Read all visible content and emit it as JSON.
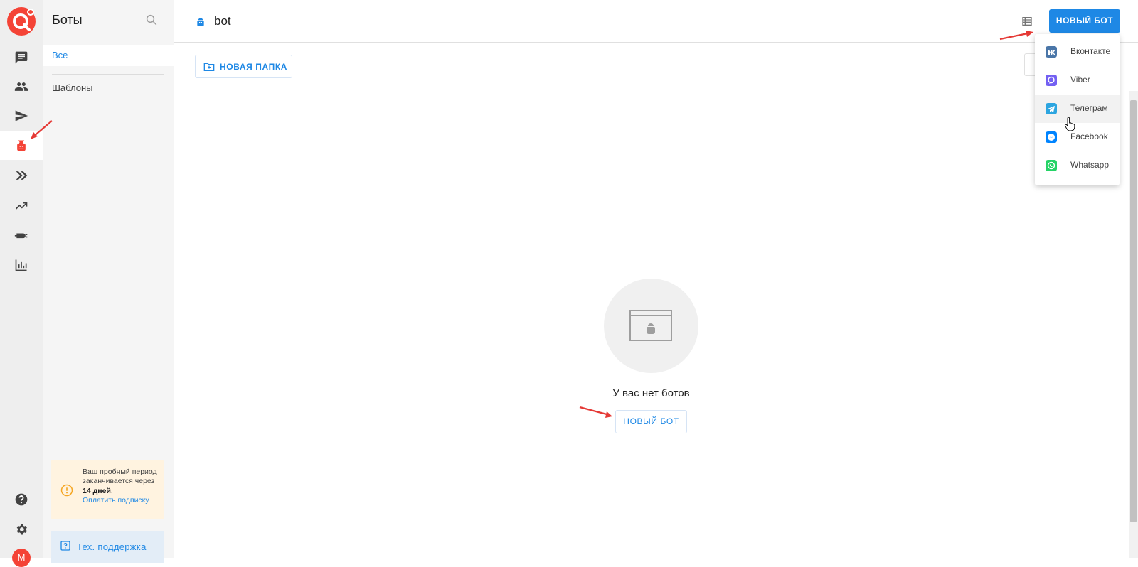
{
  "sidebar": {
    "title": "Боты",
    "all_label": "Все",
    "templates_label": "Шаблоны",
    "trial": {
      "line1": "Ваш пробный период заканчивается через ",
      "days": "14 дней",
      "period": ".",
      "link": "Оплатить подписку"
    },
    "support_label": "Тех. поддержка",
    "avatar_letter": "M"
  },
  "rail": {
    "items": [
      "chat-icon",
      "people-icon",
      "send-icon",
      "bot-icon",
      "chevrons-icon",
      "trending-icon",
      "plug-icon",
      "stats-icon"
    ],
    "active": "bot-icon",
    "bottom": [
      "help-icon",
      "gear-icon"
    ]
  },
  "header": {
    "title": "bot",
    "new_bot_label": "НОВЫЙ БОТ"
  },
  "toolbar": {
    "new_folder_label": "НОВАЯ ПАПКА"
  },
  "empty_state": {
    "message": "У вас нет ботов",
    "button_label": "НОВЫЙ БОТ"
  },
  "dropdown": {
    "items": [
      {
        "label": "Вконтакте",
        "icon": "vk-icon",
        "color": "#4a76a8"
      },
      {
        "label": "Viber",
        "icon": "viber-icon",
        "color": "#7360f2"
      },
      {
        "label": "Телеграм",
        "icon": "telegram-icon",
        "color": "#2ca5e0"
      },
      {
        "label": "Facebook",
        "icon": "messenger-icon",
        "color": "#0084ff"
      },
      {
        "label": "Whatsapp",
        "icon": "whatsapp-icon",
        "color": "#25d366"
      }
    ],
    "hovered": "Телеграм"
  },
  "colors": {
    "accent": "#1e88e5",
    "brand": "#f44336",
    "annotation_arrow": "#e53935"
  }
}
